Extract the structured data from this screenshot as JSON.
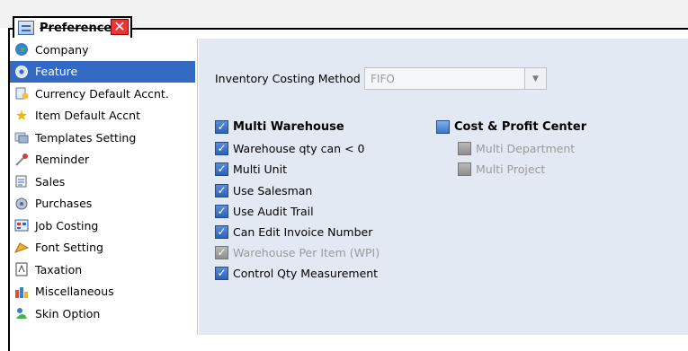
{
  "window": {
    "tab_title": "Preference",
    "close_symbol": "✕"
  },
  "sidebar": {
    "items": [
      {
        "label": "Company",
        "icon": "globe-icon",
        "selected": false
      },
      {
        "label": "Feature",
        "icon": "gear-icon",
        "selected": true
      },
      {
        "label": "Currency Default Accnt.",
        "icon": "currency-icon",
        "selected": false
      },
      {
        "label": "Item Default Accnt",
        "icon": "star-icon",
        "selected": false
      },
      {
        "label": "Templates Setting",
        "icon": "templates-icon",
        "selected": false
      },
      {
        "label": "Reminder",
        "icon": "reminder-icon",
        "selected": false
      },
      {
        "label": "Sales",
        "icon": "sales-icon",
        "selected": false
      },
      {
        "label": "Purchases",
        "icon": "purchases-icon",
        "selected": false
      },
      {
        "label": "Job Costing",
        "icon": "job-costing-icon",
        "selected": false
      },
      {
        "label": "Font Setting",
        "icon": "font-icon",
        "selected": false
      },
      {
        "label": "Taxation",
        "icon": "taxation-icon",
        "selected": false
      },
      {
        "label": "Miscellaneous",
        "icon": "miscellaneous-icon",
        "selected": false
      },
      {
        "label": "Skin Option",
        "icon": "skin-icon",
        "selected": false
      }
    ]
  },
  "main": {
    "costing_label": "Inventory Costing Method",
    "costing_value": "FIFO",
    "left_options": [
      {
        "label": "Multi Warehouse",
        "checked": true,
        "bold": true,
        "enabled": true
      },
      {
        "label": "Warehouse qty can < 0",
        "checked": true,
        "bold": false,
        "enabled": true
      },
      {
        "label": "Multi Unit",
        "checked": true,
        "bold": false,
        "enabled": true
      },
      {
        "label": "Use Salesman",
        "checked": true,
        "bold": false,
        "enabled": true
      },
      {
        "label": "Use Audit Trail",
        "checked": true,
        "bold": false,
        "enabled": true
      },
      {
        "label": "Can Edit Invoice Number",
        "checked": true,
        "bold": false,
        "enabled": true
      },
      {
        "label": "Warehouse Per Item (WPI)",
        "checked": true,
        "bold": false,
        "enabled": false
      },
      {
        "label": "Control Qty Measurement",
        "checked": true,
        "bold": false,
        "enabled": true
      }
    ],
    "right_options": [
      {
        "label": "Cost & Profit Center",
        "checked": false,
        "bold": true,
        "enabled": true
      },
      {
        "label": "Multi Department",
        "checked": false,
        "bold": false,
        "enabled": false
      },
      {
        "label": "Multi Project",
        "checked": false,
        "bold": false,
        "enabled": false
      }
    ]
  },
  "colors": {
    "selection": "#3369c3",
    "panel_bg": "#e3e9f3",
    "checkbox": "#2c62b8",
    "disabled_text": "#9a9a9a"
  }
}
